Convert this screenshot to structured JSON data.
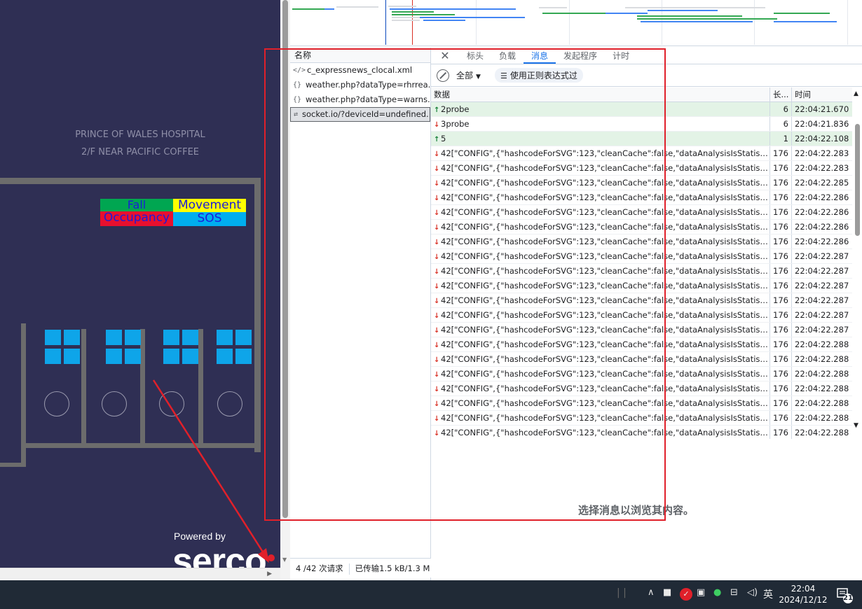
{
  "floorplan": {
    "title_line1": "PRINCE OF WALES HOSPITAL",
    "title_line2": "2/F NEAR PACIFIC COFFEE",
    "legend": {
      "fall": "Fall",
      "movement": "Movement",
      "occupancy": "Occupancy",
      "sos": "SOS"
    },
    "powered_by": "Powered by",
    "brand": "serco"
  },
  "network": {
    "names_header": "名称",
    "requests": [
      {
        "icon": "xml-file-icon",
        "glyph": "</>",
        "name": "c_expressnews_clocal.xml"
      },
      {
        "icon": "json-icon",
        "glyph": "{}",
        "name": "weather.php?dataType=rhrrea..."
      },
      {
        "icon": "json-icon",
        "glyph": "{}",
        "name": "weather.php?dataType=warns..."
      },
      {
        "icon": "websocket-icon",
        "glyph": "⇄",
        "name": "socket.io/?deviceId=undefined..."
      }
    ],
    "status_requests": "4 /42 次请求",
    "status_transferred": "已传输1.5 kB/1.3 M"
  },
  "detail": {
    "tabs": [
      "标头",
      "负载",
      "消息",
      "发起程序",
      "计时"
    ],
    "active_tab": "消息",
    "filter_select": "全部",
    "regex_label": "使用正则表达式过",
    "columns": {
      "data": "数据",
      "length": "长...",
      "time": "时间"
    },
    "messages": [
      {
        "dir": "up",
        "data": "2probe",
        "len": "6",
        "time": "22:04:21.670"
      },
      {
        "dir": "down",
        "data": "3probe",
        "len": "6",
        "time": "22:04:21.836"
      },
      {
        "dir": "up",
        "data": "5",
        "len": "1",
        "time": "22:04:22.108"
      },
      {
        "dir": "down",
        "data": "42[\"CONFIG\",{\"hashcodeForSVG\":123,\"cleanCache\":false,\"dataAnalysisIsStatistics\":true,...",
        "len": "176",
        "time": "22:04:22.283"
      },
      {
        "dir": "down",
        "data": "42[\"CONFIG\",{\"hashcodeForSVG\":123,\"cleanCache\":false,\"dataAnalysisIsStatistics\":true,...",
        "len": "176",
        "time": "22:04:22.283"
      },
      {
        "dir": "down",
        "data": "42[\"CONFIG\",{\"hashcodeForSVG\":123,\"cleanCache\":false,\"dataAnalysisIsStatistics\":true,...",
        "len": "176",
        "time": "22:04:22.285"
      },
      {
        "dir": "down",
        "data": "42[\"CONFIG\",{\"hashcodeForSVG\":123,\"cleanCache\":false,\"dataAnalysisIsStatistics\":true,...",
        "len": "176",
        "time": "22:04:22.286"
      },
      {
        "dir": "down",
        "data": "42[\"CONFIG\",{\"hashcodeForSVG\":123,\"cleanCache\":false,\"dataAnalysisIsStatistics\":true,...",
        "len": "176",
        "time": "22:04:22.286"
      },
      {
        "dir": "down",
        "data": "42[\"CONFIG\",{\"hashcodeForSVG\":123,\"cleanCache\":false,\"dataAnalysisIsStatistics\":true,...",
        "len": "176",
        "time": "22:04:22.286"
      },
      {
        "dir": "down",
        "data": "42[\"CONFIG\",{\"hashcodeForSVG\":123,\"cleanCache\":false,\"dataAnalysisIsStatistics\":true,...",
        "len": "176",
        "time": "22:04:22.286"
      },
      {
        "dir": "down",
        "data": "42[\"CONFIG\",{\"hashcodeForSVG\":123,\"cleanCache\":false,\"dataAnalysisIsStatistics\":true,...",
        "len": "176",
        "time": "22:04:22.287"
      },
      {
        "dir": "down",
        "data": "42[\"CONFIG\",{\"hashcodeForSVG\":123,\"cleanCache\":false,\"dataAnalysisIsStatistics\":true,...",
        "len": "176",
        "time": "22:04:22.287"
      },
      {
        "dir": "down",
        "data": "42[\"CONFIG\",{\"hashcodeForSVG\":123,\"cleanCache\":false,\"dataAnalysisIsStatistics\":true,...",
        "len": "176",
        "time": "22:04:22.287"
      },
      {
        "dir": "down",
        "data": "42[\"CONFIG\",{\"hashcodeForSVG\":123,\"cleanCache\":false,\"dataAnalysisIsStatistics\":true,...",
        "len": "176",
        "time": "22:04:22.287"
      },
      {
        "dir": "down",
        "data": "42[\"CONFIG\",{\"hashcodeForSVG\":123,\"cleanCache\":false,\"dataAnalysisIsStatistics\":true,...",
        "len": "176",
        "time": "22:04:22.287"
      },
      {
        "dir": "down",
        "data": "42[\"CONFIG\",{\"hashcodeForSVG\":123,\"cleanCache\":false,\"dataAnalysisIsStatistics\":true,...",
        "len": "176",
        "time": "22:04:22.287"
      },
      {
        "dir": "down",
        "data": "42[\"CONFIG\",{\"hashcodeForSVG\":123,\"cleanCache\":false,\"dataAnalysisIsStatistics\":true,...",
        "len": "176",
        "time": "22:04:22.288"
      },
      {
        "dir": "down",
        "data": "42[\"CONFIG\",{\"hashcodeForSVG\":123,\"cleanCache\":false,\"dataAnalysisIsStatistics\":true,...",
        "len": "176",
        "time": "22:04:22.288"
      },
      {
        "dir": "down",
        "data": "42[\"CONFIG\",{\"hashcodeForSVG\":123,\"cleanCache\":false,\"dataAnalysisIsStatistics\":true,...",
        "len": "176",
        "time": "22:04:22.288"
      },
      {
        "dir": "down",
        "data": "42[\"CONFIG\",{\"hashcodeForSVG\":123,\"cleanCache\":false,\"dataAnalysisIsStatistics\":true,...",
        "len": "176",
        "time": "22:04:22.288"
      },
      {
        "dir": "down",
        "data": "42[\"CONFIG\",{\"hashcodeForSVG\":123,\"cleanCache\":false,\"dataAnalysisIsStatistics\":true,...",
        "len": "176",
        "time": "22:04:22.288"
      },
      {
        "dir": "down",
        "data": "42[\"CONFIG\",{\"hashcodeForSVG\":123,\"cleanCache\":false,\"dataAnalysisIsStatistics\":true,...",
        "len": "176",
        "time": "22:04:22.288"
      },
      {
        "dir": "down",
        "data": "42[\"CONFIG\",{\"hashcodeForSVG\":123,\"cleanCache\":false,\"dataAnalysisIsStatistics\":true,...",
        "len": "176",
        "time": "22:04:22.288"
      }
    ],
    "placeholder": "选择消息以浏览其内容。"
  },
  "taskbar": {
    "ime": "英",
    "time": "22:04",
    "date": "2024/12/12",
    "notifications": "21"
  },
  "colors": {
    "floor_bg": "#2f2f54",
    "wall": "#6c6c6c",
    "legend_fall": "#00a651",
    "legend_movement": "#ffff00",
    "legend_occupancy": "#e8102e",
    "legend_sos": "#00aeef",
    "accent_blue": "#1a73e8",
    "annotation_red": "#e0202a",
    "sent_row": "#e3f3e6"
  }
}
